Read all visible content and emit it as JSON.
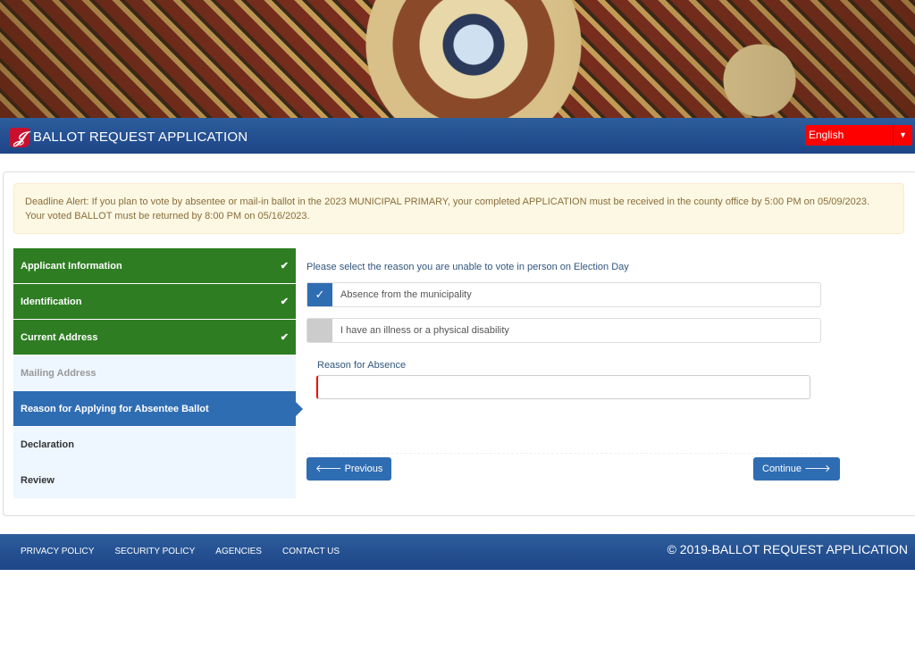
{
  "header": {
    "title": "BALLOT REQUEST APPLICATION",
    "logo_text": "J",
    "language": "English"
  },
  "alert": {
    "line1": "Deadline Alert: If you plan to vote by absentee or mail-in ballot in the 2023 MUNICIPAL PRIMARY, your completed APPLICATION must be received in the county office by 5:00 PM on 05/09/2023.",
    "line2": "Your voted BALLOT must be returned by 8:00 PM on 05/16/2023."
  },
  "steps": [
    {
      "label": "Applicant Information",
      "status": "complete"
    },
    {
      "label": "Identification",
      "status": "complete"
    },
    {
      "label": "Current Address",
      "status": "complete"
    },
    {
      "label": "Mailing Address",
      "status": "disabled"
    },
    {
      "label": "Reason for Applying for Absentee Ballot",
      "status": "active"
    },
    {
      "label": "Declaration",
      "status": "pending"
    },
    {
      "label": "Review",
      "status": "pending"
    }
  ],
  "form": {
    "question": "Please select the reason you are unable to vote in person on Election Day",
    "options": [
      {
        "label": "Absence from the municipality",
        "checked": true
      },
      {
        "label": "I have an illness or a physical disability",
        "checked": false
      }
    ],
    "reason_label": "Reason for Absence",
    "reason_value": "",
    "previous": "Previous",
    "continue": "Continue"
  },
  "footer": {
    "links": [
      "PRIVACY POLICY",
      "SECURITY POLICY",
      "AGENCIES",
      "CONTACT US"
    ],
    "copyright": "© 2019-BALLOT REQUEST APPLICATION"
  },
  "colors": {
    "header": "#1d4587",
    "complete": "#2e7d23",
    "active": "#2f6db3",
    "language": "#ff0000"
  }
}
